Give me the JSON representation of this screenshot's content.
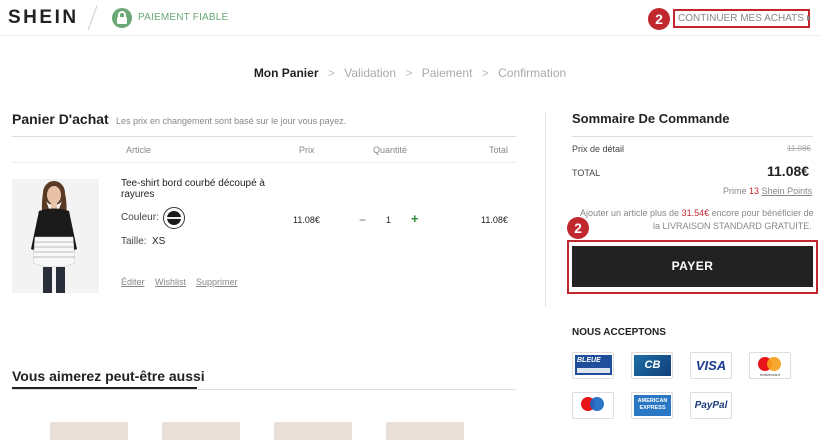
{
  "header": {
    "logo": "SHEIN",
    "secure_label": "PAIEMENT FIABLE",
    "continue_label": "CONTINUER MES ACHATS",
    "marker_top": "2",
    "marker_pay": "2"
  },
  "steps": [
    "Mon Panier",
    "Validation",
    "Paiement",
    "Confirmation"
  ],
  "step_separator": ">",
  "cart": {
    "title": "Panier D'achat",
    "note": "Les prix en changement sont basé sur le jour vous payez.",
    "headers": {
      "article": "Article",
      "price": "Prix",
      "quantity": "Quantité",
      "total": "Total"
    },
    "item": {
      "name": "Tee-shirt bord courbé découpé à rayures",
      "color_label": "Couleur:",
      "size_label": "Taille:",
      "size": "XS",
      "price": "11.08€",
      "qty_minus": "−",
      "quantity": "1",
      "qty_plus": "+",
      "total": "11.08€",
      "links": {
        "edit": "Éditer",
        "wishlist": "Wishlist",
        "delete": "Supprimer"
      }
    }
  },
  "recommend": {
    "title": "Vous aimerez peut-être aussi"
  },
  "summary": {
    "title": "Sommaire De Commande",
    "retail_label": "Prix de détail",
    "retail_value": "11.08€",
    "total_label": "TOTAL",
    "total_value": "11.08€",
    "points_prefix": "Prime",
    "points_value": "13",
    "points_link": "Shein Points",
    "shipping_line1_a": "Ajouter un article plus de",
    "shipping_amount": "31.54€",
    "shipping_line1_b": "encore pour bénéficier de",
    "shipping_line2": "la LIVRAISON STANDARD GRATUITE.",
    "pay_label": "PAYER",
    "accept_title": "NOUS ACCEPTONS",
    "cards": {
      "cb_bleue": "BLEUE",
      "cb": "CB",
      "visa": "VISA",
      "mastercard": "mastercard",
      "amex_line1": "AMERICAN",
      "amex_line2": "EXPRESS",
      "paypal": "PayPal"
    }
  },
  "colors": {
    "accent_red": "#c0282e",
    "secure_green": "#6aa874",
    "plus_green": "#2e8b3a",
    "pay_button": "#222222"
  }
}
